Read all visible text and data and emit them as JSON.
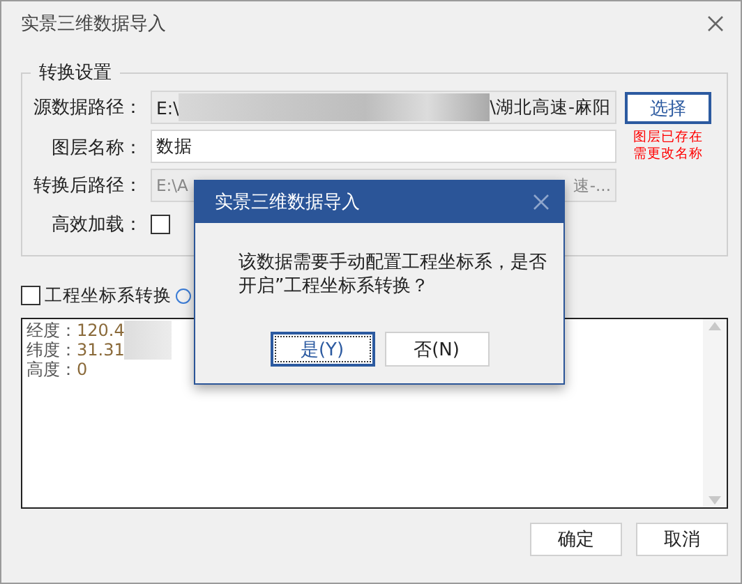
{
  "window": {
    "title": "实景三维数据导入"
  },
  "settings_group": {
    "title": "转换设置",
    "source_path": {
      "label": "源数据路径：",
      "value_start": "E:\\",
      "value_end": "\\湖北高速-麻阳"
    },
    "select_button": "选择",
    "warning_lines": [
      "图层已存在",
      "需更改名称"
    ],
    "layer_name": {
      "label": "图层名称：",
      "value": "数据"
    },
    "output_path": {
      "label": "转换后路径：",
      "value_start": "E:\\A",
      "value_end": "速-..."
    },
    "efficient_load": {
      "label": "高效加载：",
      "checked": false
    }
  },
  "coord_transform": {
    "label": "工程坐标系转换",
    "checked": false
  },
  "log": [
    {
      "label": "经度：",
      "value": "120.4"
    },
    {
      "label": "纬度：",
      "value": "31.31"
    },
    {
      "label": "高度：",
      "value": "0"
    }
  ],
  "buttons": [
    "确定",
    "取消"
  ],
  "modal": {
    "title": "实景三维数据导入",
    "message_lines": [
      "该数据需要手动配置工程坐标系，是否",
      "开启”工程坐标系转换？"
    ],
    "buttons": [
      {
        "label": "是(Y)",
        "selected": true
      },
      {
        "label": "否(N)",
        "selected": false
      }
    ]
  }
}
